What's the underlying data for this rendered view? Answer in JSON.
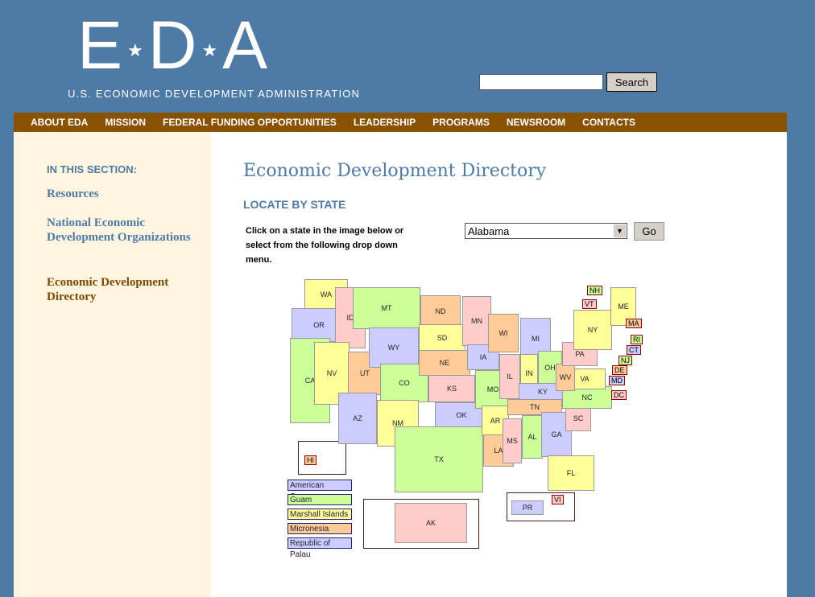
{
  "header": {
    "logo_letters": [
      "E",
      "D",
      "A"
    ],
    "logo_subtitle": "U.S. ECONOMIC DEVELOPMENT ADMINISTRATION",
    "search_value": "",
    "search_label": "Search"
  },
  "nav": [
    "ABOUT EDA",
    "MISSION",
    "FEDERAL FUNDING OPPORTUNITIES",
    "LEADERSHIP",
    "PROGRAMS",
    "NEWSROOM",
    "CONTACTS"
  ],
  "sidebar": {
    "heading": "IN THIS SECTION:",
    "items": [
      {
        "label": "Resources"
      },
      {
        "label": "National Economic Development Organizations"
      },
      {
        "label": "Economic Development Directory",
        "active": true
      }
    ]
  },
  "main": {
    "title": "Economic Development Directory",
    "subtitle": "LOCATE BY STATE",
    "instructions": "Click on a state in the image below or select from the following drop down menu.",
    "select_value": "Alabama",
    "go_label": "Go"
  },
  "colors": {
    "blue": "#ccccff",
    "green": "#ccff99",
    "yellow": "#ffff99",
    "orange": "#ffcc99",
    "pink": "#ffcccc",
    "accent": "#4e7aa6",
    "nav": "#8a5200",
    "active_link": "#7a4a00"
  },
  "map": {
    "states": [
      {
        "abbr": "WA",
        "color": "yellow"
      },
      {
        "abbr": "OR",
        "color": "blue"
      },
      {
        "abbr": "CA",
        "color": "green"
      },
      {
        "abbr": "ID",
        "color": "pink"
      },
      {
        "abbr": "NV",
        "color": "yellow"
      },
      {
        "abbr": "UT",
        "color": "orange"
      },
      {
        "abbr": "AZ",
        "color": "blue"
      },
      {
        "abbr": "MT",
        "color": "green"
      },
      {
        "abbr": "WY",
        "color": "blue"
      },
      {
        "abbr": "CO",
        "color": "green"
      },
      {
        "abbr": "NM",
        "color": "yellow"
      },
      {
        "abbr": "ND",
        "color": "orange"
      },
      {
        "abbr": "SD",
        "color": "yellow"
      },
      {
        "abbr": "NE",
        "color": "orange"
      },
      {
        "abbr": "KS",
        "color": "pink"
      },
      {
        "abbr": "OK",
        "color": "blue"
      },
      {
        "abbr": "TX",
        "color": "green"
      },
      {
        "abbr": "MN",
        "color": "pink"
      },
      {
        "abbr": "IA",
        "color": "blue"
      },
      {
        "abbr": "MO",
        "color": "green"
      },
      {
        "abbr": "AR",
        "color": "yellow"
      },
      {
        "abbr": "LA",
        "color": "orange"
      },
      {
        "abbr": "WI",
        "color": "orange"
      },
      {
        "abbr": "IL",
        "color": "pink"
      },
      {
        "abbr": "MI",
        "color": "blue"
      },
      {
        "abbr": "IN",
        "color": "yellow"
      },
      {
        "abbr": "OH",
        "color": "green"
      },
      {
        "abbr": "KY",
        "color": "blue"
      },
      {
        "abbr": "TN",
        "color": "orange"
      },
      {
        "abbr": "MS",
        "color": "pink"
      },
      {
        "abbr": "AL",
        "color": "green"
      },
      {
        "abbr": "GA",
        "color": "blue"
      },
      {
        "abbr": "FL",
        "color": "yellow"
      },
      {
        "abbr": "SC",
        "color": "pink"
      },
      {
        "abbr": "NC",
        "color": "green"
      },
      {
        "abbr": "VA",
        "color": "yellow"
      },
      {
        "abbr": "WV",
        "color": "orange"
      },
      {
        "abbr": "PA",
        "color": "pink"
      },
      {
        "abbr": "NY",
        "color": "yellow"
      },
      {
        "abbr": "ME",
        "color": "yellow"
      },
      {
        "abbr": "AK",
        "color": "pink"
      },
      {
        "abbr": "PR",
        "color": "blue"
      }
    ],
    "tags": [
      {
        "abbr": "NH",
        "color": "green"
      },
      {
        "abbr": "VT",
        "color": "pink"
      },
      {
        "abbr": "MA",
        "color": "orange"
      },
      {
        "abbr": "RI",
        "color": "green"
      },
      {
        "abbr": "CT",
        "color": "blue"
      },
      {
        "abbr": "NJ",
        "color": "green"
      },
      {
        "abbr": "DE",
        "color": "orange"
      },
      {
        "abbr": "MD",
        "color": "blue"
      },
      {
        "abbr": "DC",
        "color": "pink"
      },
      {
        "abbr": "HI",
        "color": "orange"
      },
      {
        "abbr": "VI",
        "color": "pink"
      }
    ],
    "territories": [
      {
        "label": "American Samoa",
        "color": "blue"
      },
      {
        "label": "Guam",
        "color": "green"
      },
      {
        "label": "Marshall Islands",
        "color": "yellow"
      },
      {
        "label": "Micronesia",
        "color": "orange"
      },
      {
        "label": "Republic of Palau",
        "color": "blue"
      }
    ]
  }
}
